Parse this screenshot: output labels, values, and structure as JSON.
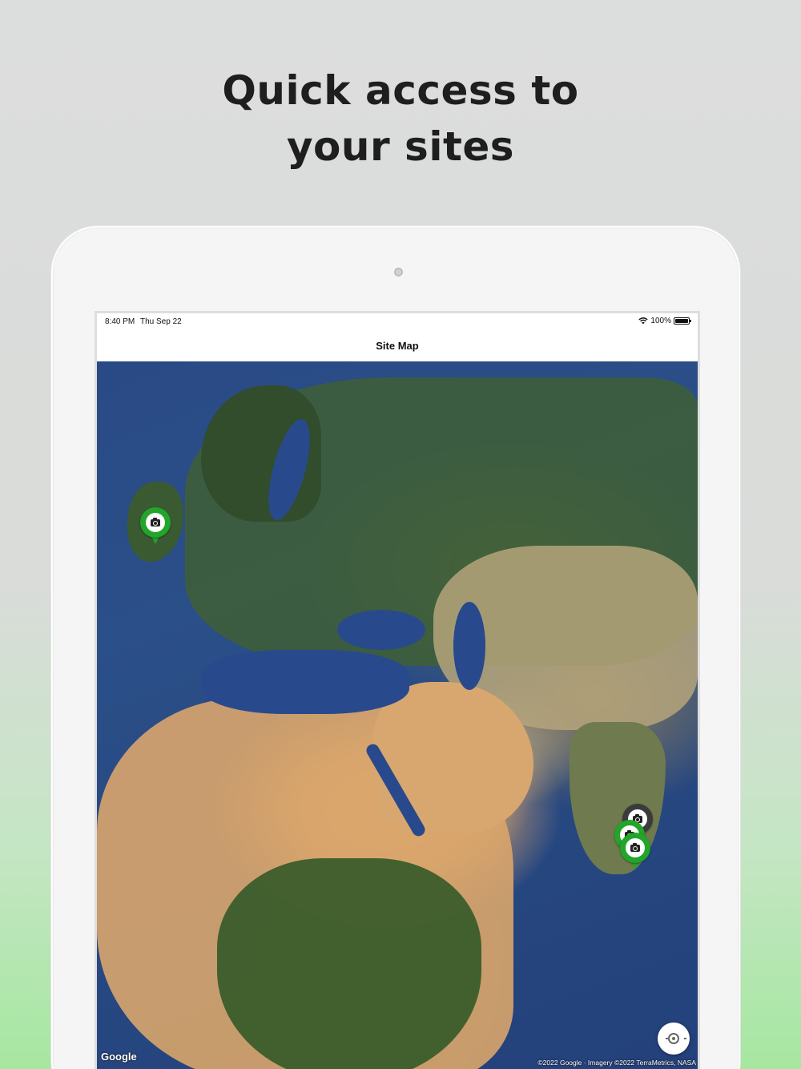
{
  "headline": {
    "line1": "Quick access to",
    "line2": "your sites"
  },
  "status_bar": {
    "time": "8:40 PM",
    "date": "Thu Sep 22",
    "battery": "100%",
    "icons": [
      "wifi-icon",
      "battery-icon"
    ]
  },
  "nav": {
    "title": "Site Map"
  },
  "map": {
    "pins": [
      {
        "label": "uk-site",
        "color": "#22a52a",
        "icon": "camera-icon"
      },
      {
        "label": "south-india-site-1",
        "color": "#3a3a3a",
        "icon": "camera-icon"
      },
      {
        "label": "south-india-site-2",
        "color": "#22a52a",
        "icon": "camera-icon"
      },
      {
        "label": "south-india-site-3",
        "color": "#22a52a",
        "icon": "camera-icon"
      }
    ],
    "logo_text": "Google",
    "credits": "©2022 Google · Imagery ©2022 TerraMetrics, NASA",
    "locate_icon": "crosshair-icon"
  },
  "colors": {
    "pin_green": "#22a52a",
    "pin_dark": "#3a3a3a",
    "headline": "#1e1e1e"
  }
}
